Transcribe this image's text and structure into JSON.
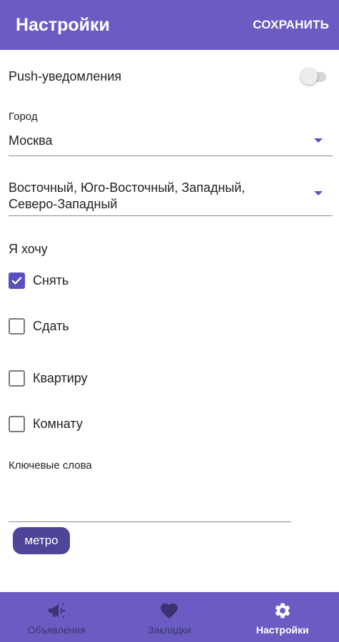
{
  "appbar": {
    "title": "Настройки",
    "action": "СОХРАНИТЬ"
  },
  "push": {
    "label": "Push-уведомления",
    "enabled": false
  },
  "city": {
    "label": "Город",
    "value": "Москва"
  },
  "districts": {
    "line1": "Восточный, Юго-Восточный, Западный,",
    "line2": "Северо-Западный"
  },
  "want": {
    "label": "Я хочу",
    "options": [
      {
        "label": "Снять",
        "checked": true
      },
      {
        "label": "Сдать",
        "checked": false
      },
      {
        "label": "Квартиру",
        "checked": false
      },
      {
        "label": "Комнату",
        "checked": false
      }
    ]
  },
  "keywords": {
    "label": "Ключевые слова",
    "value": "",
    "chips": [
      "метро"
    ]
  },
  "bottom_nav": {
    "items": [
      {
        "label": "Объявления",
        "icon": "megaphone-icon",
        "active": false
      },
      {
        "label": "Закладки",
        "icon": "heart-icon",
        "active": false
      },
      {
        "label": "Настройки",
        "icon": "gear-icon",
        "active": true
      }
    ]
  },
  "colors": {
    "primary": "#6a5cc3",
    "accent": "#5b4fc0",
    "chip": "#4d4598",
    "nav_inactive": "#3c3470"
  }
}
